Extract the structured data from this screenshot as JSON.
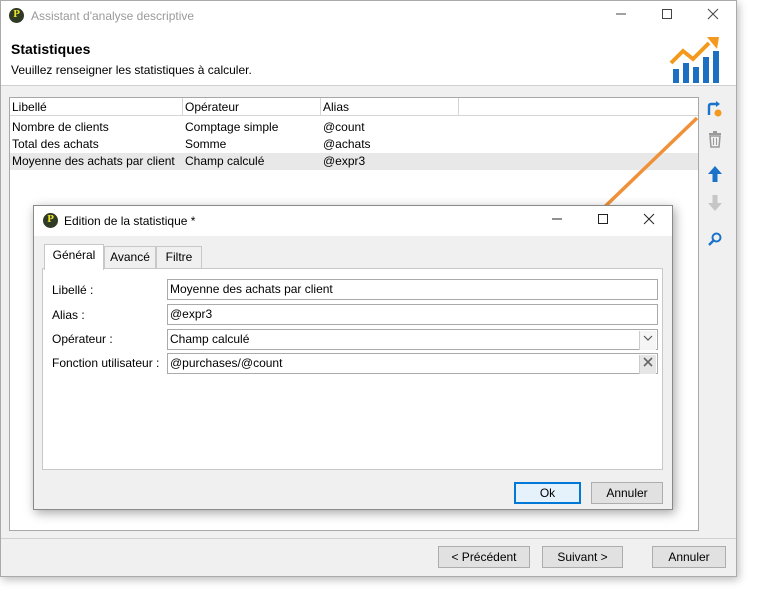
{
  "window": {
    "title": "Assistant d'analyse descriptive"
  },
  "header": {
    "title": "Statistiques",
    "subtitle": "Veuillez renseigner les statistiques à calculer."
  },
  "list": {
    "columns": [
      "Libellé",
      "Opérateur",
      "Alias"
    ],
    "rows": [
      {
        "libelle": "Nombre de clients",
        "operateur": "Comptage simple",
        "alias": "@count"
      },
      {
        "libelle": "Total des achats",
        "operateur": "Somme",
        "alias": "@achats"
      },
      {
        "libelle": "Moyenne des achats par client",
        "operateur": "Champ calculé",
        "alias": "@expr3"
      }
    ],
    "selected_index": 2
  },
  "toolbar": {
    "icons": [
      "add-statistic-icon",
      "delete-icon",
      "move-up-icon",
      "move-down-icon",
      "search-icon"
    ],
    "accent": "#1a73c9"
  },
  "buttons": {
    "previous": "< Précédent",
    "next": "Suivant >",
    "cancel": "Annuler"
  },
  "dialog": {
    "title": "Edition de la statistique *",
    "tabs": [
      "Général",
      "Avancé",
      "Filtre"
    ],
    "active_tab": "Général",
    "fields": {
      "libelle": {
        "label": "Libellé :",
        "value": "Moyenne des achats par client"
      },
      "alias": {
        "label": "Alias :",
        "value": "@expr3"
      },
      "operateur": {
        "label": "Opérateur :",
        "value": "Champ calculé"
      },
      "fonction": {
        "label": "Fonction utilisateur :",
        "value": "@purchases/@count"
      }
    },
    "ok": "Ok",
    "cancel": "Annuler"
  },
  "colors": {
    "arrow": "#f0913a",
    "chart_orange": "#f39a1e",
    "chart_blue": "#1d6fc2"
  }
}
